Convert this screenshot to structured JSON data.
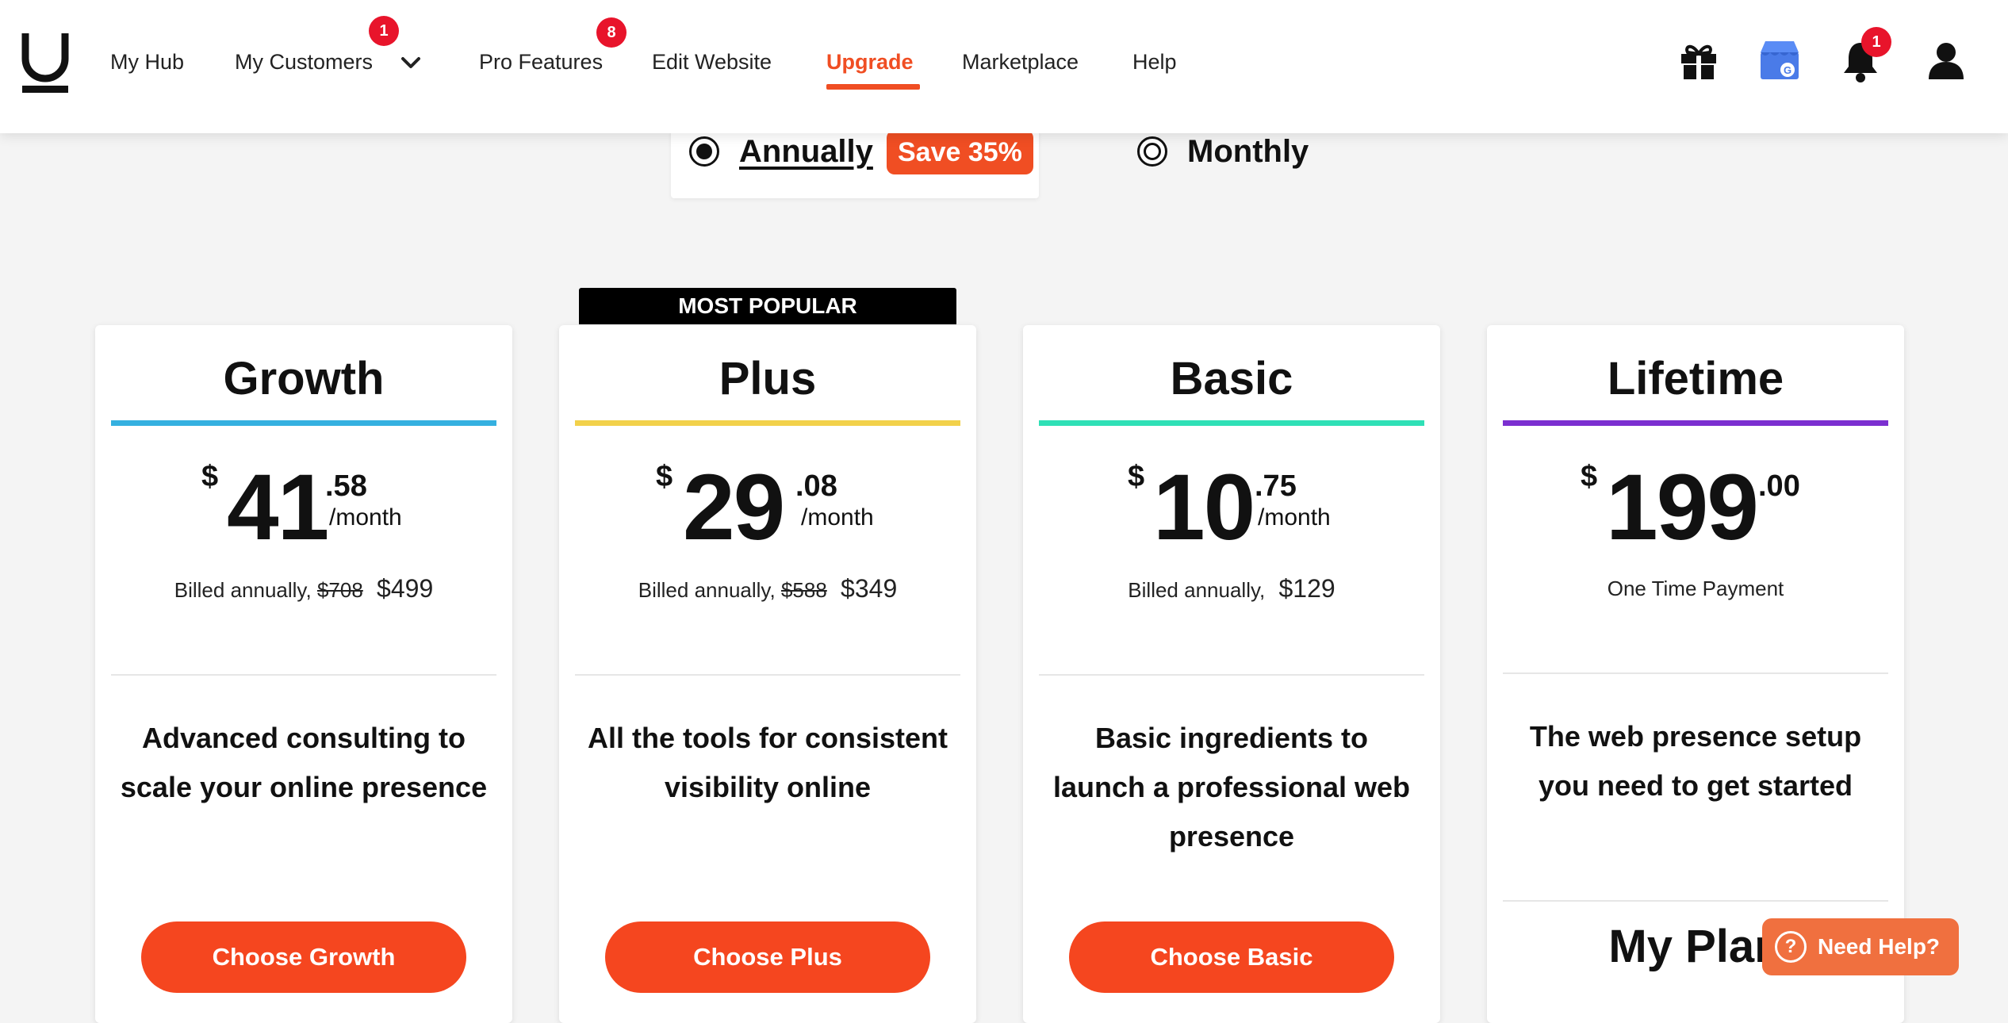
{
  "nav": {
    "items": [
      {
        "label": "My Hub",
        "badge": null
      },
      {
        "label": "My Customers",
        "badge": "1"
      },
      {
        "label": "Pro Features",
        "badge": "8"
      },
      {
        "label": "Edit Website",
        "badge": null
      },
      {
        "label": "Upgrade",
        "badge": null,
        "active": true
      },
      {
        "label": "Marketplace",
        "badge": null
      },
      {
        "label": "Help",
        "badge": null
      }
    ],
    "notification_badge": "1",
    "icons": [
      "gift-icon",
      "google-business-icon",
      "bell-icon",
      "user-icon"
    ]
  },
  "billing": {
    "annually_label": "Annually",
    "save_label": "Save 35%",
    "monthly_label": "Monthly",
    "selected": "annually"
  },
  "colors": {
    "accent": "#f04e23",
    "growth": "#35b0e0",
    "plus": "#f2d14a",
    "basic": "#2fe0b6",
    "lifetime": "#7b2fd0"
  },
  "popular_tag": "MOST POPULAR",
  "plans": [
    {
      "name": "Growth",
      "currency": "$",
      "whole": "41",
      "cents": ".58",
      "per": "/month",
      "billed_prefix": "Billed annually,",
      "old_price": "$708",
      "new_price": "$499",
      "description": "Advanced consulting to scale your online presence",
      "button": "Choose Growth"
    },
    {
      "name": "Plus",
      "currency": "$",
      "whole": "29",
      "cents": ".08",
      "per": "/month",
      "billed_prefix": "Billed annually,",
      "old_price": "$588",
      "new_price": "$349",
      "description": "All the tools for consistent visibility online",
      "button": "Choose Plus"
    },
    {
      "name": "Basic",
      "currency": "$",
      "whole": "10",
      "cents": ".75",
      "per": "/month",
      "billed_prefix": "Billed annually,",
      "old_price": "",
      "new_price": "$129",
      "description": "Basic ingredients to launch a professional web presence",
      "button": "Choose Basic"
    },
    {
      "name": "Lifetime",
      "currency": "$",
      "whole": "199",
      "cents": ".00",
      "per": "",
      "billed_text": "One Time Payment",
      "description": "The web presence setup you need to get started",
      "my_plan": "My Plan"
    }
  ],
  "help_button": "Need Help?"
}
